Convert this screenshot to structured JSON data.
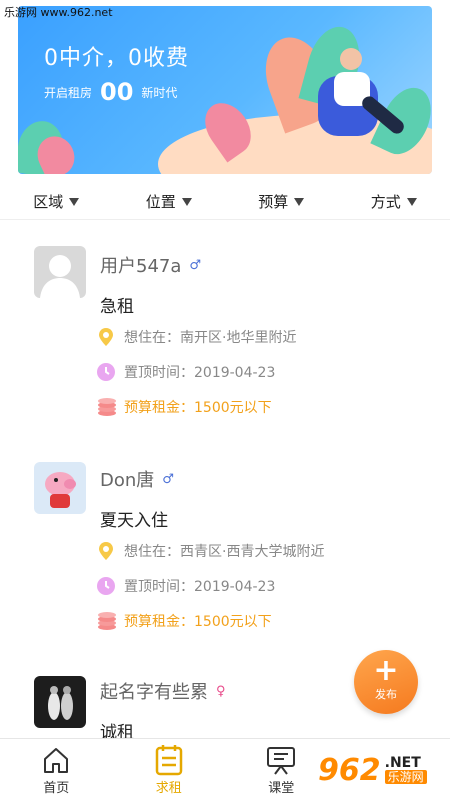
{
  "watermark": {
    "top_text": "乐游网 www.962.net",
    "logo": "962",
    "logo_net": ".NET",
    "logo_cn": "乐游网"
  },
  "banner": {
    "headline": "0中介，0收费",
    "sub_left": "开启租房",
    "sub_big": "00",
    "sub_right": "新时代"
  },
  "filters": [
    {
      "label": "区域",
      "icon": "caret-down-icon"
    },
    {
      "label": "位置",
      "icon": "caret-down-icon"
    },
    {
      "label": "预算",
      "icon": "caret-down-icon"
    },
    {
      "label": "方式",
      "icon": "caret-down-icon"
    }
  ],
  "listings": [
    {
      "username": "用户547a",
      "gender": "♂",
      "gender_color": "#4a6fd6",
      "title": "急租",
      "location": "想住在：南开区·地华里附近",
      "pin_time": "置顶时间：2019-04-23",
      "budget": "预算租金：1500元以下"
    },
    {
      "username": "Don唐",
      "gender": "♂",
      "gender_color": "#4a6fd6",
      "title": "夏天入住",
      "location": "想住在：西青区·西青大学城附近",
      "pin_time": "置顶时间：2019-04-23",
      "budget": "预算租金：1500元以下"
    },
    {
      "username": "起名字有些累",
      "gender": "♀",
      "gender_color": "#e84c8b",
      "title": "诚租"
    }
  ],
  "fab": {
    "label": "发布",
    "icon": "plus-icon"
  },
  "tabbar": [
    {
      "label": "首页",
      "icon": "home-icon",
      "active": false
    },
    {
      "label": "求租",
      "icon": "notepad-icon",
      "active": true
    },
    {
      "label": "课堂",
      "icon": "presentation-board-icon",
      "active": false
    }
  ],
  "colors": {
    "accent": "#e5a800",
    "budget": "#f2a11b",
    "banner": "#3aa0ff",
    "fab": "#f57a1f"
  }
}
